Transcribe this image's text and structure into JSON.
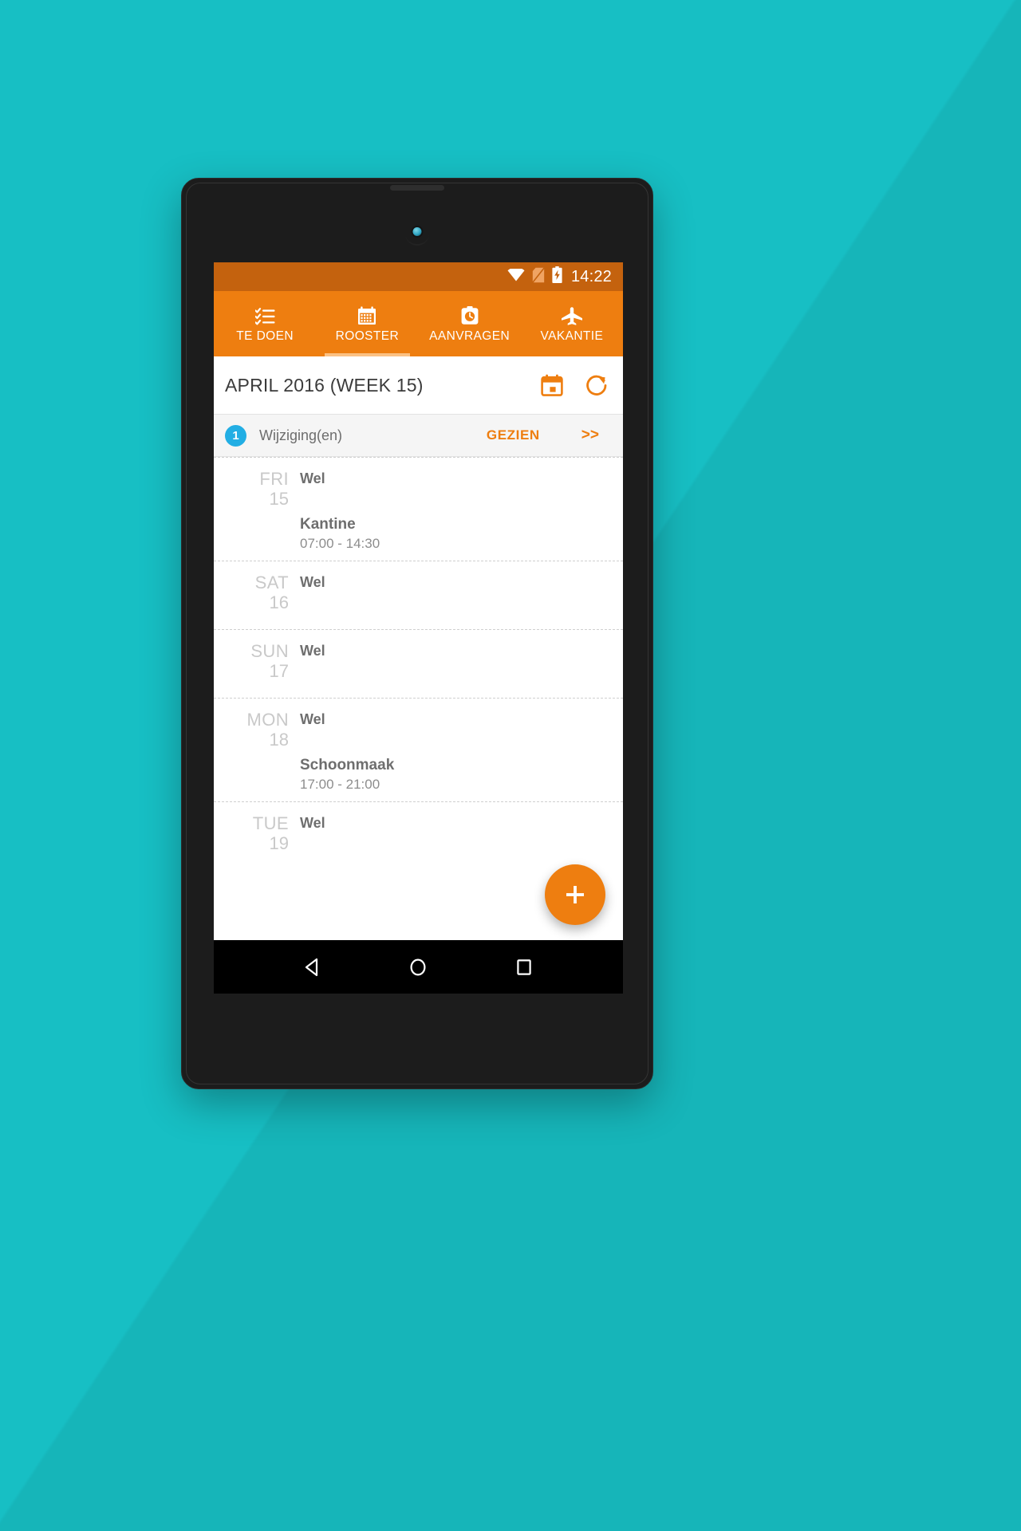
{
  "background": {
    "color": "#17bfc4"
  },
  "theme": {
    "accent": "#ee7e10",
    "status_bar": "#c4620e",
    "badge": "#22aee4",
    "indicator": "#fbc183"
  },
  "status_bar": {
    "time": "14:22",
    "icons": [
      "wifi-icon",
      "no-sim-icon",
      "battery-charging-icon"
    ]
  },
  "tabs": [
    {
      "label": "TE DOEN",
      "icon": "checklist-icon",
      "active": false
    },
    {
      "label": "ROOSTER",
      "icon": "calendar-icon",
      "active": true
    },
    {
      "label": "AANVRAGEN",
      "icon": "timer-icon",
      "active": false
    },
    {
      "label": "VAKANTIE",
      "icon": "airplane-icon",
      "active": false
    }
  ],
  "header": {
    "title": "APRIL 2016 (WEEK 15)",
    "actions": [
      {
        "name": "date-picker-icon"
      },
      {
        "name": "refresh-icon"
      }
    ]
  },
  "changes_bar": {
    "count": "1",
    "label": "Wijziging(en)",
    "action_label": "GEZIEN",
    "next_label": ">>"
  },
  "schedule": {
    "days": [
      {
        "dow": "FRI",
        "day": "15",
        "status": "Wel",
        "shifts": [
          {
            "name": "Kantine",
            "time": "07:00 - 14:30"
          }
        ]
      },
      {
        "dow": "SAT",
        "day": "16",
        "status": "Wel",
        "shifts": []
      },
      {
        "dow": "SUN",
        "day": "17",
        "status": "Wel",
        "shifts": []
      },
      {
        "dow": "MON",
        "day": "18",
        "status": "Wel",
        "shifts": [
          {
            "name": "Schoonmaak",
            "time": "17:00 - 21:00"
          }
        ]
      },
      {
        "dow": "TUE",
        "day": "19",
        "status": "Wel",
        "shifts": []
      }
    ]
  },
  "fab": {
    "label": "+",
    "name": "add-button"
  },
  "nav_bar": {
    "buttons": [
      {
        "name": "back-button"
      },
      {
        "name": "home-button"
      },
      {
        "name": "recents-button"
      }
    ]
  }
}
